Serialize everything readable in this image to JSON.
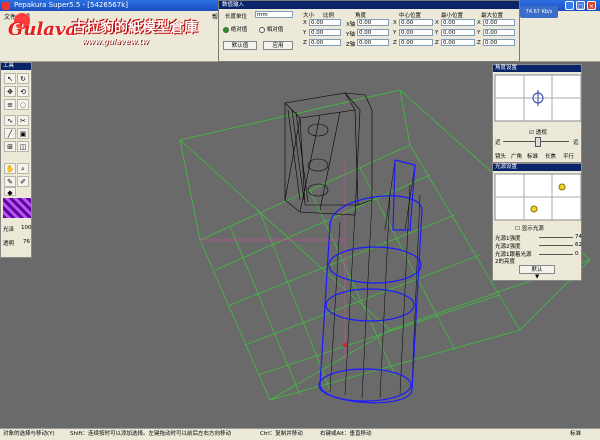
{
  "window": {
    "title": "Pepakura Super5.5 - [5426567k]"
  },
  "logo": {
    "brand": "Gulava",
    "text": "古拉豹的紙模型倉庫",
    "url": "www.gulavew.tw"
  },
  "menubar": {
    "items": [
      "文件",
      "编辑",
      "帮"
    ]
  },
  "numeric_dialog": {
    "title": "数值输入",
    "unit_label": "长度单位",
    "unit_value": "mm",
    "coord_absolute": "绝对值",
    "coord_relative": "相对值",
    "btn_default": "默认值",
    "btn_apply": "应用",
    "headers": {
      "size": "大小",
      "ratio": "比例",
      "angle": "角度",
      "center": "中心位置",
      "min": "最小位置",
      "max": "最大位置"
    },
    "axis_x": "X",
    "axis_y": "Y",
    "axis_z": "Z",
    "angle_x": "X轴",
    "angle_y": "Y轴",
    "angle_z": "Z轴",
    "zero": "0.00"
  },
  "network": {
    "speed": "74.67 Kb/s"
  },
  "tool_panel": {
    "title": "工具",
    "gloss_label": "光泽",
    "gloss_value": "100",
    "transparency_label": "透明",
    "transparency_value": "76"
  },
  "view_panel": {
    "title": "角度设置",
    "perspective_label": "透视",
    "near_label": "近",
    "far_label": "远",
    "lens_label": "镜头",
    "lens_options": [
      "广角",
      "标准",
      "长焦",
      "平行"
    ]
  },
  "light_panel": {
    "title": "光源设置",
    "show_light": "显示光源",
    "light_intensity_label": "光源1强度",
    "light_intensity_value": "74",
    "light2_intensity_label": "光源2强度",
    "light2_intensity_value": "62",
    "ambient_label": "光源1跟着光源",
    "ambient_label2": "2的亮度",
    "ambient_value": "0",
    "btn_default": "默认"
  },
  "statusbar": {
    "hint1": "对象的选择与移动(Y)",
    "hint2": "Shift：连续按时可以添加选择。左键拖动时可以前后左右方向移动",
    "hint3": "Ctrl：复制并移动",
    "hint4": "右键或Alt：垂直移动",
    "mode": "标准"
  },
  "colors": {
    "titlebar": "#1a4fbf",
    "viewport": "#6a6a6a",
    "grid": "#3fbf3f",
    "wire": "#000000",
    "wire_blue": "#1a1aff"
  }
}
